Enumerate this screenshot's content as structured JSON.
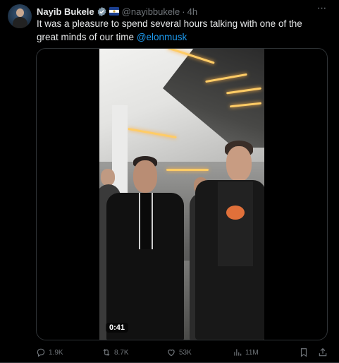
{
  "tweet": {
    "author_name": "Nayib Bukele",
    "handle": "@nayibbukele",
    "separator": "·",
    "time": "4h",
    "text_before_mention": "It was a pleasure to spend several hours talking with one of the great minds of our time ",
    "mention": "@elonmusk",
    "media": {
      "duration": "0:41"
    }
  },
  "actions": {
    "replies": "1.9K",
    "reposts": "8.7K",
    "likes": "53K",
    "views": "11M"
  },
  "colors": {
    "accent": "#1d9bf0",
    "muted": "#71767b",
    "text": "#e7e9ea",
    "background": "#000000"
  }
}
